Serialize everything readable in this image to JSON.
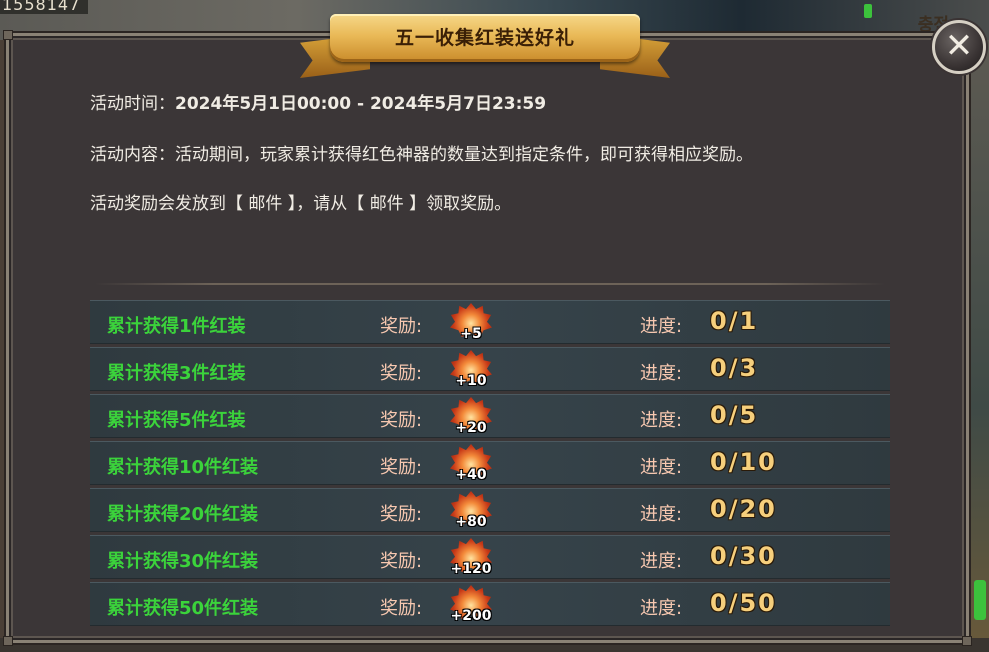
{
  "background": {
    "top_left_text": "1558147",
    "top_right_label": "충전"
  },
  "title": "五一收集红装送好礼",
  "info": {
    "time_label": "活动时间：",
    "time_value": "2024年5月1日00:00 - 2024年5月7日23:59",
    "content": "活动内容：活动期间，玩家累计获得红色神器的数量达到指定条件，即可获得相应奖励。",
    "mail_note": "活动奖励会发放到【 邮件 】，请从【 邮件 】领取奖励。"
  },
  "labels": {
    "reward": "奖励:",
    "progress": "进度:"
  },
  "rows": [
    {
      "label": "累计获得1件红装",
      "reward_qty": "+5",
      "progress": "0/1"
    },
    {
      "label": "累计获得3件红装",
      "reward_qty": "+10",
      "progress": "0/3"
    },
    {
      "label": "累计获得5件红装",
      "reward_qty": "+20",
      "progress": "0/5"
    },
    {
      "label": "累计获得10件红装",
      "reward_qty": "+40",
      "progress": "0/10"
    },
    {
      "label": "累计获得20件红装",
      "reward_qty": "+80",
      "progress": "0/20"
    },
    {
      "label": "累计获得30件红装",
      "reward_qty": "+120",
      "progress": "0/30"
    },
    {
      "label": "累计获得50件红装",
      "reward_qty": "+200",
      "progress": "0/50"
    }
  ],
  "colors": {
    "row_label": "#3bd33b",
    "progress_value": "#f6cf7c",
    "panel_bg": "#3b3637"
  },
  "icons": {
    "close": "close-icon",
    "reward": "red-flame-token-icon"
  }
}
